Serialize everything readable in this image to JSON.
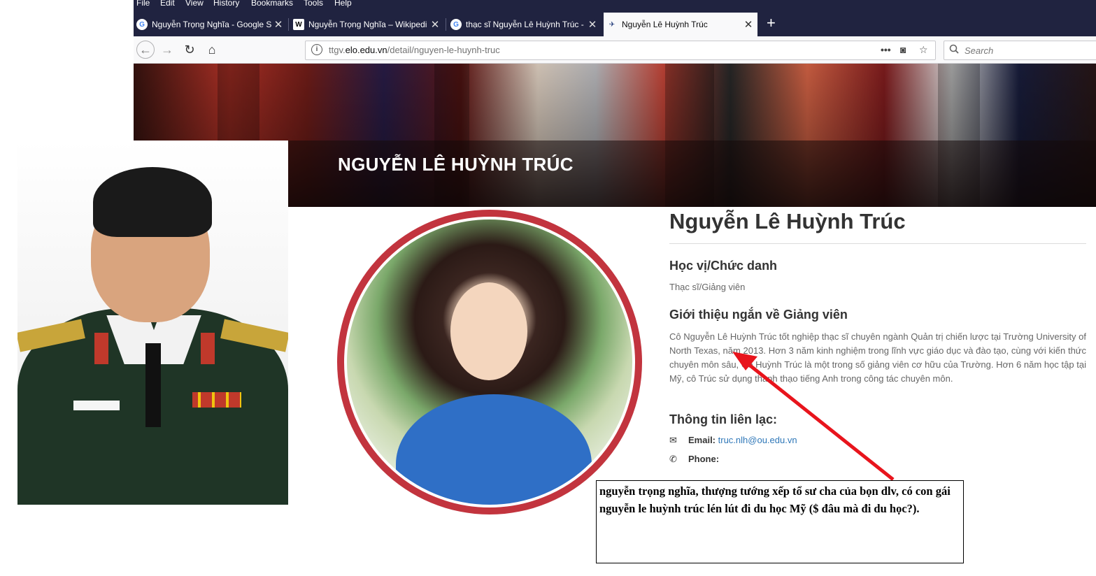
{
  "menu": [
    "File",
    "Edit",
    "View",
    "History",
    "Bookmarks",
    "Tools",
    "Help"
  ],
  "tabs": [
    {
      "title": "Nguyễn Trọng Nghĩa - Google S",
      "favicon": "google-icon",
      "fav_char": "G"
    },
    {
      "title": "Nguyễn Trọng Nghĩa – Wikipedi",
      "favicon": "wikipedia-icon",
      "fav_char": "W"
    },
    {
      "title": "thạc sĩ Nguyễn Lê Huỳnh Trúc -",
      "favicon": "google-icon",
      "fav_char": "G"
    },
    {
      "title": "Nguyễn Lê Huỳnh Trúc",
      "favicon": "site-icon",
      "fav_char": "✈"
    }
  ],
  "url": {
    "domain_prefix": "ttgv.",
    "domain": "elo.edu.vn",
    "path": "/detail/nguyen-le-huynh-truc"
  },
  "search": {
    "placeholder": "Search"
  },
  "banner": {
    "title": "NGUYỄN LÊ HUỲNH TRÚC"
  },
  "profile": {
    "name": "Nguyễn Lê Huỳnh Trúc",
    "degree_heading": "Học vị/Chức danh",
    "degree": "Thạc sĩ/Giảng viên",
    "intro_heading": "Giới thiệu ngắn về Giảng viên",
    "bio": "Cô Nguyễn Lê Huỳnh Trúc tốt nghiệp thạc sĩ chuyên ngành Quản trị chiến lược tại Trường University of North Texas, năm 2013. Hơn 3 năm kinh nghiệm trong lĩnh vực giáo dục và đào tạo, cùng với kiến thức chuyên môn sâu, Cô Huỳnh Trúc là một trong số giảng viên cơ hữu của Trường. Hơn 6 năm học tập tại Mỹ, cô Trúc sử dụng thành thạo tiếng Anh trong công tác chuyên môn.",
    "contact_heading": "Thông tin liên lạc:",
    "email_label": "Email:",
    "email": "truc.nlh@ou.edu.vn",
    "phone_label": "Phone:"
  },
  "caption": "nguyễn trọng nghĩa, thượng tướng xếp tổ sư cha của bọn dlv, có con gái nguyễn le huỳnh trúc lén lút đi du học Mỹ ($ đâu mà đi du học?).",
  "colors": {
    "menubar": "#202340",
    "ring": "#c2343e",
    "link": "#2e77b8",
    "arrow": "#e8141c"
  }
}
